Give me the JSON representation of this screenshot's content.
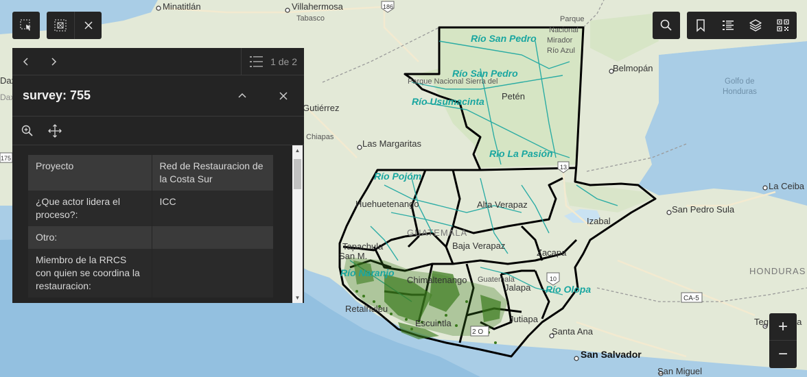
{
  "map": {
    "places": {
      "minatitlan": "Minatitlán",
      "villahermosa": "Villahermosa",
      "tabasco": "Tabasco",
      "parque": "Parque",
      "nacional": "Nacional",
      "mirador": "Mirador",
      "rio_azul": "Río Azul",
      "parque_nacional_sierra": "Parque Nacional Sierra del",
      "belmopan": "Belmopán",
      "golfo": "Golfo de",
      "honduras_gulf": "Honduras",
      "peten": "Petén",
      "gutierrez": "Gutiérrez",
      "chiapas": "Chiapas",
      "las_margaritas": "Las Margaritas",
      "huehuetenango": "Huehuetenango",
      "alta_verapaz": "Alta Verapaz",
      "izabal": "Izabal",
      "la_ceiba": "La Ceiba",
      "san_pedro_sula": "San Pedro Sula",
      "guatemala": "GUATEMALA",
      "tapachula": "Tapachula",
      "san_marcos": "San M.",
      "baja_verapaz": "Baja Verapaz",
      "zacapa": "Zacapa",
      "chimaltenango": "Chimaltenango",
      "guatemala_dept": "Guatemala",
      "jalapa": "Jalapa",
      "honduras": "HONDURAS",
      "retalhuleu": "Retalhuleu",
      "escuintla": "Escuintla",
      "jutiapa": "Jutiapa",
      "tegucigalpa": "Tegucigalpa",
      "santa_ana": "Santa Ana",
      "san_salvador": "San Salvador",
      "san_miguel": "San Miguel",
      "daxa": "Daxa",
      "dax": "Dax"
    },
    "rivers": {
      "san_pedro_1": "Río San Pedro",
      "san_pedro_2": "Río San Pedro",
      "usumacinta": "Río Usumacinta",
      "la_pasion": "Río La Pasión",
      "pojom": "Río Pojóm",
      "naranjo": "Río Naranjo",
      "olopa": "Río Olopa"
    },
    "shields": {
      "r186": "186",
      "r13": "13",
      "r10": "10",
      "r175": "175",
      "ca5": "CA-5",
      "r2": "2 O"
    }
  },
  "toolbar_left": {
    "select_icon": "select-icon",
    "select_area_icon": "select-area-icon",
    "close_icon": "close-icon"
  },
  "toolbar_right": {
    "search_icon": "search-icon",
    "bookmark_icon": "bookmark-icon",
    "list_icon": "list-icon",
    "layers_icon": "layers-icon",
    "qr_icon": "qr-icon"
  },
  "popup": {
    "title": "survey: 755",
    "page_count": "1 de 2",
    "rows": [
      {
        "field": "Proyecto",
        "value": "Red de Restauracion de la Costa Sur"
      },
      {
        "field": "¿Que actor lidera el proceso?:",
        "value": "ICC"
      },
      {
        "field": "Otro:",
        "value": ""
      },
      {
        "field": "Miembro de la RRCS con quien se coordina la restauracion:",
        "value": ""
      }
    ]
  },
  "zoom": {
    "in_label": "+",
    "out_label": "−"
  },
  "colors": {
    "panel": "#242424",
    "river": "#19a6a0",
    "boundary": "#000000",
    "sites": "#3a7a1c"
  }
}
